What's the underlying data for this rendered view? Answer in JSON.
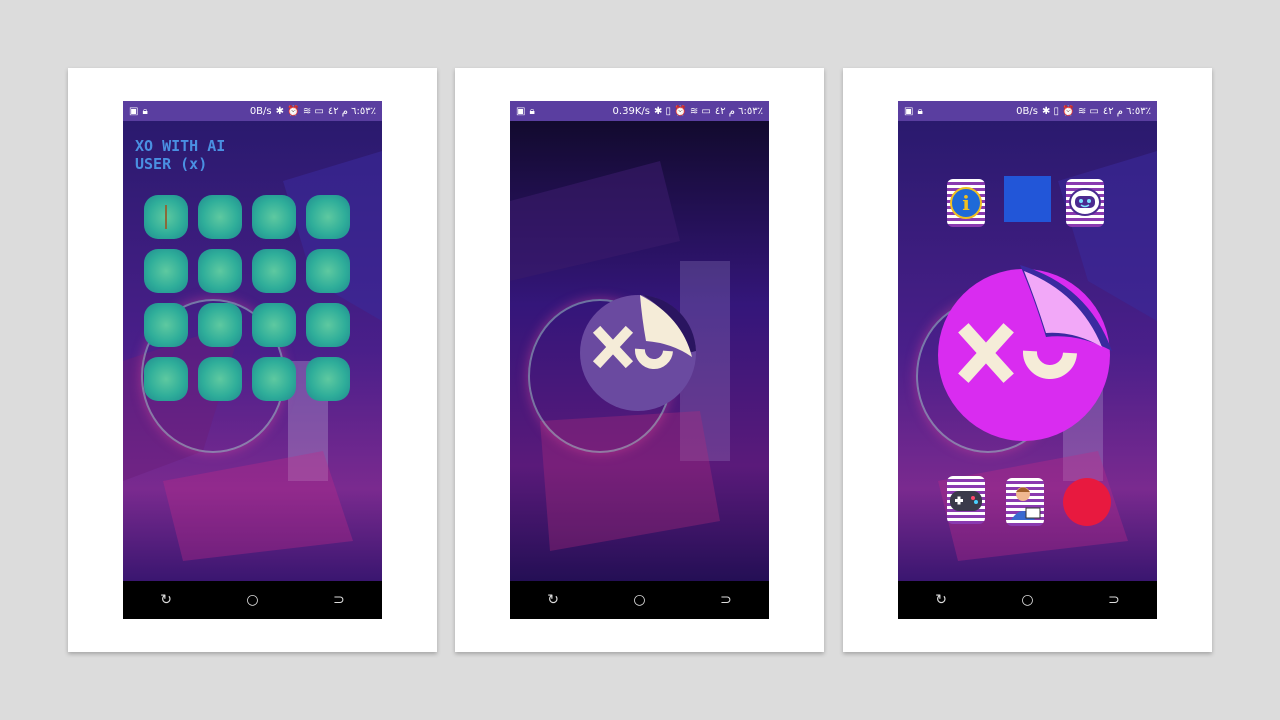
{
  "status_bars": [
    {
      "speed": "0B/s",
      "time": "٦:٥٣ م ٤٢٪"
    },
    {
      "speed": "0.39K/s",
      "time": "٦:٥٣ م ٤٢٪"
    },
    {
      "speed": "0B/s",
      "time": "٦:٥٣ م ٤٢٪"
    }
  ],
  "screen1": {
    "title_line1": "XO WITH AI",
    "title_line2": "USER (x)"
  },
  "screen2": {
    "logo_text": "XO"
  },
  "screen3": {
    "logo_text": "XO",
    "top_icons": [
      "info-icon",
      "blue-square-icon",
      "robot-chat-icon"
    ],
    "bottom_icons": [
      "gamepad-icon",
      "developer-icon",
      "record-icon"
    ]
  },
  "colors": {
    "status_bar": "#5a3ea0",
    "grid_cell": "#2fae9a",
    "title": "#4a90e2",
    "logo_purple": "#6a4aa0",
    "logo_magenta": "#d92cf0",
    "record_red": "#e8193f"
  }
}
